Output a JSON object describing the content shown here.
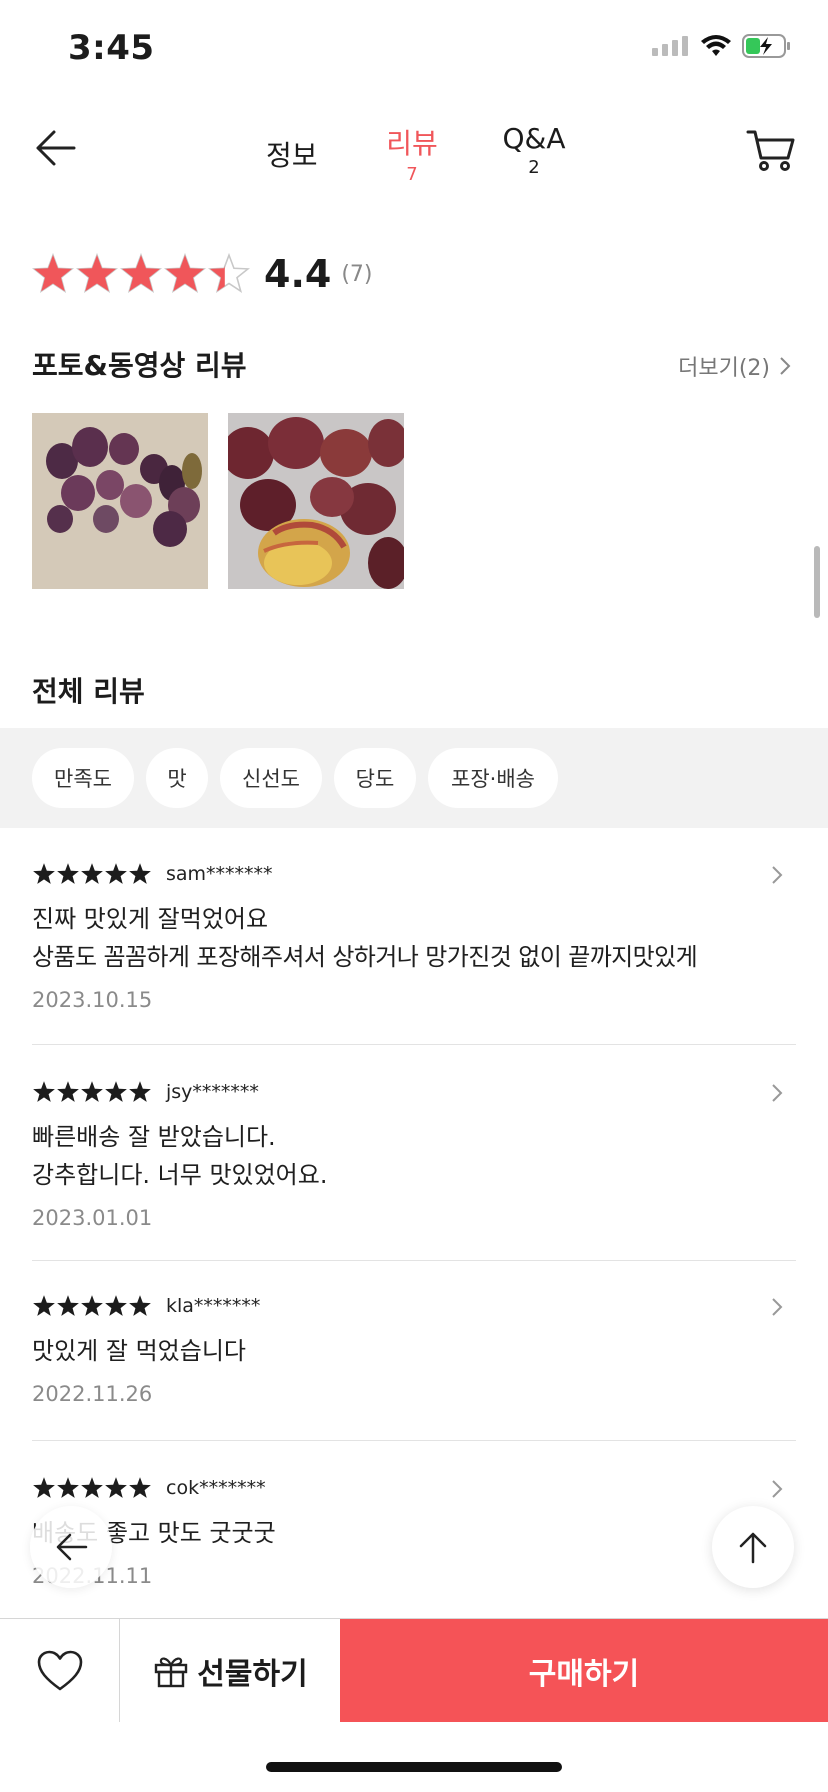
{
  "status_bar": {
    "time": "3:45"
  },
  "header": {
    "tabs": [
      {
        "label": "정보",
        "count": ""
      },
      {
        "label": "리뷰",
        "count": "7"
      },
      {
        "label": "Q&A",
        "count": "2"
      }
    ],
    "active_tab": "리뷰",
    "accent_color": "#f0565a"
  },
  "rating": {
    "score": "4.4",
    "count": "(7)",
    "stars_value": 4.4,
    "stars_max": 5
  },
  "photo_reviews": {
    "title": "포토&동영상 리뷰",
    "more_label": "더보기(2)"
  },
  "all_reviews": {
    "title": "전체 리뷰",
    "filters": [
      "만족도",
      "맛",
      "신선도",
      "당도",
      "포장·배송"
    ]
  },
  "reviews": [
    {
      "user": "sam*******",
      "stars": 5,
      "lines": [
        "진짜 맛있게 잘먹었어요",
        "상품도 꼼꼼하게 포장해주셔서 상하거나 망가진것 없이 끝까지맛있게"
      ],
      "date": "2023.10.15"
    },
    {
      "user": "jsy*******",
      "stars": 5,
      "lines": [
        "빠른배송 잘 받았습니다.",
        "강추합니다. 너무 맛있었어요."
      ],
      "date": "2023.01.01"
    },
    {
      "user": "kla*******",
      "stars": 5,
      "lines": [
        "맛있게 잘 먹었습니다"
      ],
      "date": "2022.11.26"
    },
    {
      "user": "cok*******",
      "stars": 5,
      "lines": [
        "배송도 좋고 맛도 굿굿굿"
      ],
      "date": "2022.11.11"
    }
  ],
  "bottom_bar": {
    "gift_label": "선물하기",
    "buy_label": "구매하기",
    "buy_color": "#f55357"
  },
  "icons": {
    "back": "arrow-left-icon",
    "cart": "cart-icon",
    "chevron": "chevron-right-icon",
    "heart": "heart-icon",
    "gift": "gift-icon",
    "top": "arrow-up-icon"
  }
}
